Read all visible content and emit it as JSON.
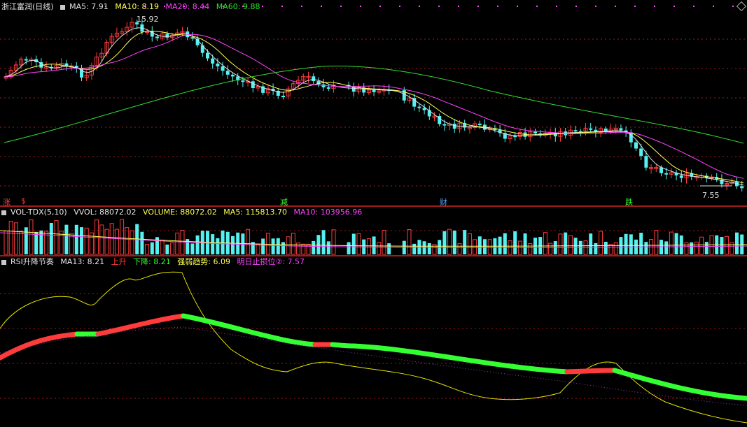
{
  "main_header": {
    "title": "浙江富润(日线)",
    "ma5": "MA5: 7.91",
    "ma10": "MA10: 8.19",
    "ma20": "MA20: 8.44",
    "ma60": "MA60: 9.88"
  },
  "price_labels": {
    "high": "15.92",
    "low": "7.55"
  },
  "marker_tags": [
    {
      "text": "涨",
      "color": "#ff3b3b"
    },
    {
      "text": "$",
      "color": "#ff3b3b"
    },
    {
      "text": "减",
      "color": "#33ff33"
    },
    {
      "text": "财",
      "color": "#4da6ff"
    },
    {
      "text": "跌",
      "color": "#33ff33"
    }
  ],
  "volume_header": {
    "name": "VOL-TDX(5,10)",
    "vvol": "VVOL: 88072.02",
    "volume": "VOLUME: 88072.02",
    "ma5": "MA5: 115813.70",
    "ma10": "MA10: 103956.96"
  },
  "rsi_header": {
    "name": "RSI升降节奏",
    "ma13": "MA13: 8.21",
    "up": "上升",
    "down": "下降: 8.21",
    "strength": "强弱趋势: 6.09",
    "stop": "明日止损位②: 7.57"
  },
  "colors": {
    "up": "#ff3b3b",
    "down": "#55f0f0",
    "ma5": "#e0e0e0",
    "ma10": "#ffff55",
    "ma20": "#ff44ff",
    "ma60": "#33dd33",
    "grid": "#9b1d1d"
  }
}
